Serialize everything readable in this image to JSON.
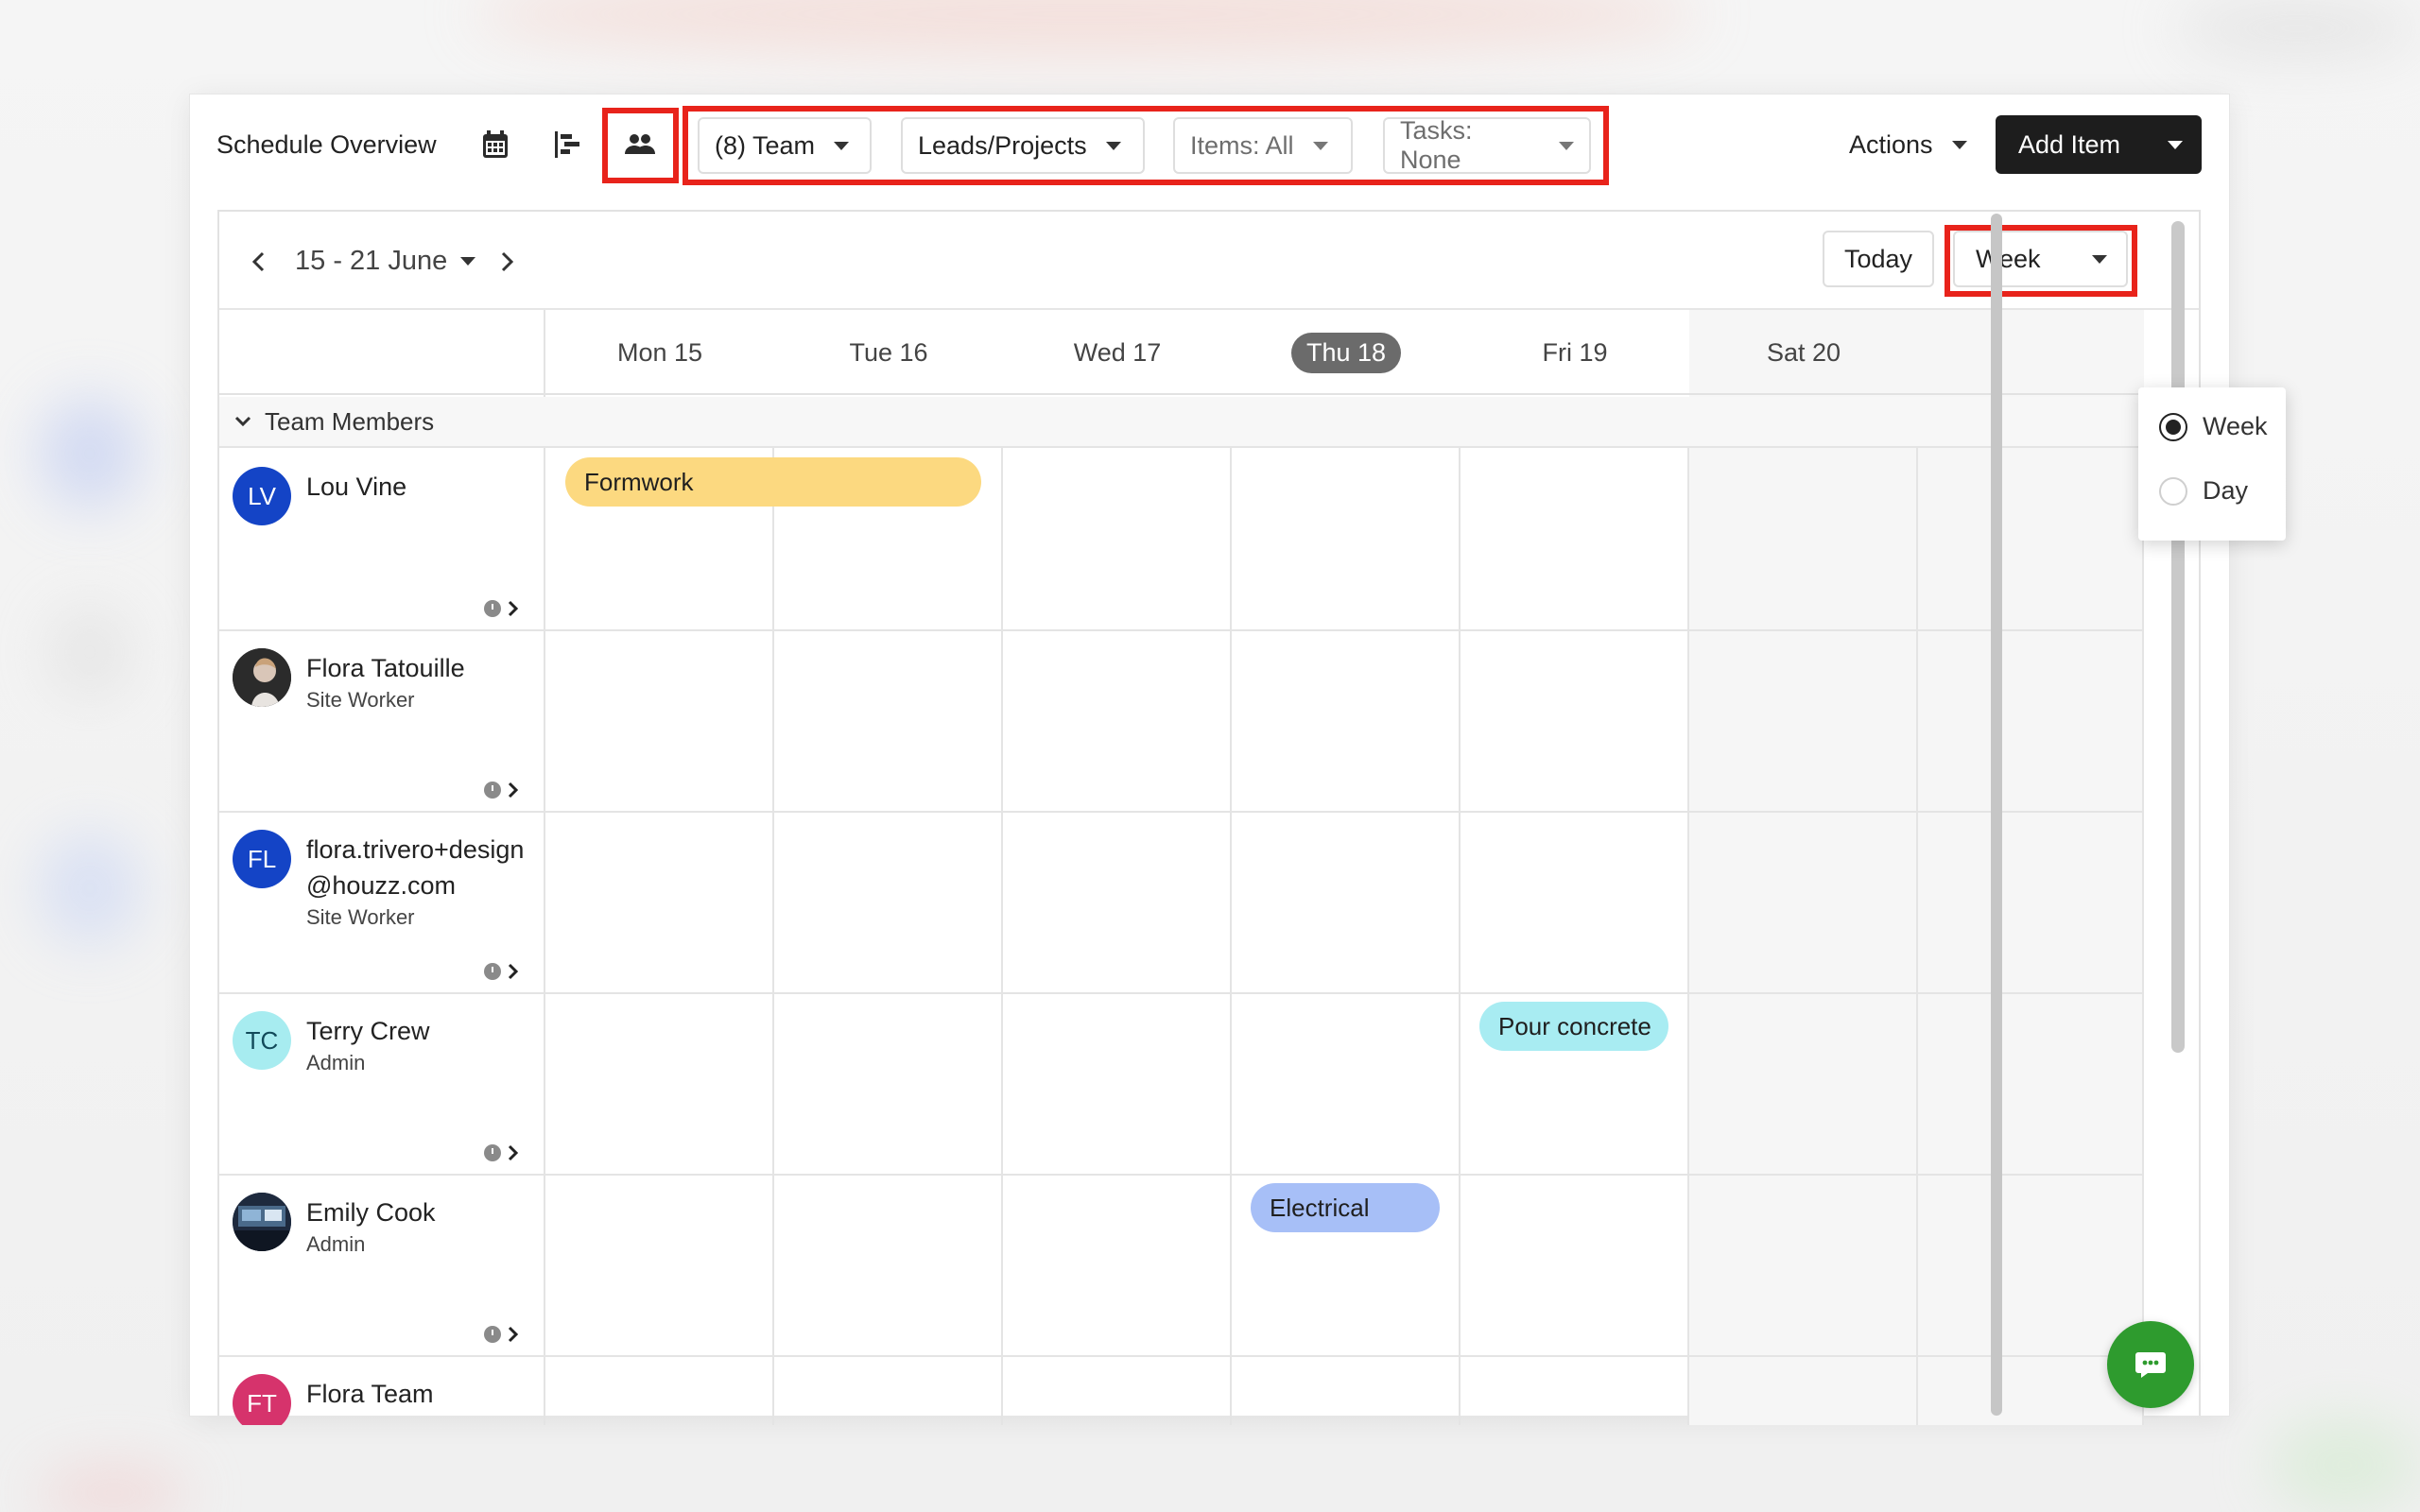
{
  "toolbar": {
    "title": "Schedule Overview",
    "filters": {
      "team": "(8) Team",
      "leads_projects": "Leads/Projects",
      "items": "Items: All",
      "tasks": "Tasks: None"
    },
    "actions_label": "Actions",
    "add_item_label": "Add Item"
  },
  "calendar": {
    "range_label": "15 - 21 June",
    "today_label": "Today",
    "view_selected": "Week",
    "view_options": [
      "Week",
      "Day"
    ],
    "days": [
      "Mon 15",
      "Tue 16",
      "Wed 17",
      "Thu 18",
      "Fri 19",
      "Sat 20"
    ],
    "today_day": "Thu 18",
    "group_label": "Team Members",
    "members": [
      {
        "initials": "LV",
        "name": "Lou Vine",
        "role": "",
        "avatar_color": "#1444c6",
        "avatar_text_color": "#ffffff"
      },
      {
        "initials": "",
        "name": "Flora Tatouille",
        "role": "Site Worker",
        "avatar_color": "#3a3a3a",
        "avatar_text_color": "#ffffff"
      },
      {
        "initials": "FL",
        "name": "flora.trivero+design@houzz.com",
        "role": "Site Worker",
        "avatar_color": "#1444c6",
        "avatar_text_color": "#ffffff"
      },
      {
        "initials": "TC",
        "name": "Terry Crew",
        "role": "Admin",
        "avatar_color": "#a7ecf0",
        "avatar_text_color": "#124a5a"
      },
      {
        "initials": "",
        "name": "Emily Cook",
        "role": "Admin",
        "avatar_color": "#2a3c5a",
        "avatar_text_color": "#ffffff"
      },
      {
        "initials": "FT",
        "name": "Flora Team",
        "role": "",
        "avatar_color": "#d6336c",
        "avatar_text_color": "#ffffff"
      }
    ],
    "events": [
      {
        "label": "Formwork",
        "color": "#fcd980"
      },
      {
        "label": "Pour concrete",
        "color": "#a8ecf2"
      },
      {
        "label": "Electrical",
        "color": "#a7bff7"
      }
    ]
  },
  "colors": {
    "highlight": "#e8231b",
    "chat_button": "#2e9b2e",
    "primary_button": "#1d1d1d"
  }
}
